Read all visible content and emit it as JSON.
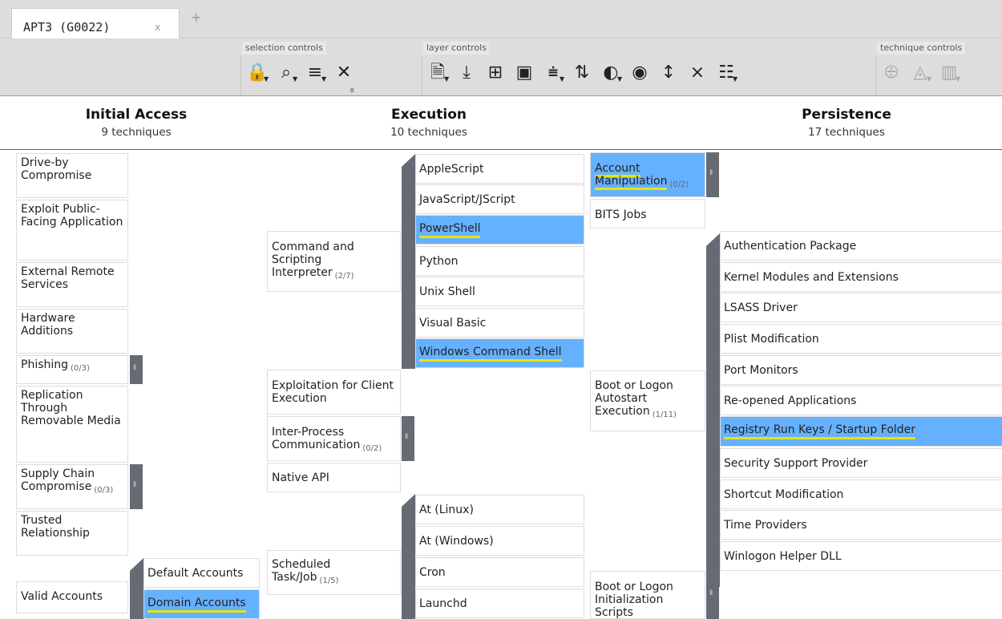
{
  "tab": {
    "title": "APT3 (G0022)",
    "close": "x",
    "add": "+"
  },
  "toolbar": {
    "groups": [
      "selection controls",
      "layer controls",
      "technique controls"
    ],
    "icons": [
      "lock-icon",
      "search-icon",
      "multiselect-icon",
      "deselect-icon",
      "layer-info-icon",
      "download-icon",
      "table-icon",
      "camera-icon",
      "filter-icon",
      "sort-icon",
      "color-palette-icon",
      "eye-icon",
      "expand-icon",
      "collapse-icon",
      "grid-layout-icon",
      "no-background-icon",
      "fill-color-icon",
      "scoring-icon"
    ],
    "deselect_count": "0"
  },
  "tactics": [
    {
      "name": "Initial Access",
      "count": "9 techniques"
    },
    {
      "name": "Execution",
      "count": "10 techniques"
    },
    {
      "name": "Persistence",
      "count": "17 techniques"
    }
  ],
  "initial_access": [
    {
      "label": "Drive-by Compromise"
    },
    {
      "label": "Exploit Public-Facing Application"
    },
    {
      "label": "External Remote Services"
    },
    {
      "label": "Hardware Additions"
    },
    {
      "label": "Phishing",
      "count": "(0/3)"
    },
    {
      "label": "Replication Through Removable Media"
    },
    {
      "label": "Supply Chain Compromise",
      "count": "(0/3)"
    },
    {
      "label": "Trusted Relationship"
    },
    {
      "label": "Valid Accounts"
    }
  ],
  "valid_accounts_subs": [
    "Default Accounts",
    "Domain Accounts"
  ],
  "execution": [
    {
      "label": "Command and Scripting Interpreter",
      "count": "(2/7)"
    },
    {
      "label": "Exploitation for Client Execution"
    },
    {
      "label": "Inter-Process Communication",
      "count": "(0/2)"
    },
    {
      "label": "Native API"
    },
    {
      "label": "Scheduled Task/Job",
      "count": "(1/5)"
    }
  ],
  "cmd_subs": [
    "AppleScript",
    "JavaScript/JScript",
    "PowerShell",
    "Python",
    "Unix Shell",
    "Visual Basic",
    "Windows Command Shell"
  ],
  "sched_subs": [
    "At (Linux)",
    "At (Windows)",
    "Cron",
    "Launchd"
  ],
  "persistence": [
    {
      "label": "Account Manipulation",
      "count": "(0/2)"
    },
    {
      "label": "BITS Jobs"
    },
    {
      "label": "Boot or Logon Autostart Execution",
      "count": "(1/11)"
    },
    {
      "label": "Boot or Logon Initialization Scripts"
    }
  ],
  "boot_subs": [
    "Authentication Package",
    "Kernel Modules and Extensions",
    "LSASS Driver",
    "Plist Modification",
    "Port Monitors",
    "Re-opened Applications",
    "Registry Run Keys / Startup Folder",
    "Security Support Provider",
    "Shortcut Modification",
    "Time Providers",
    "Winlogon Helper DLL"
  ],
  "colors": {
    "selected": "#66b1ff",
    "underline": "#e6e600",
    "handle": "#666b73"
  }
}
